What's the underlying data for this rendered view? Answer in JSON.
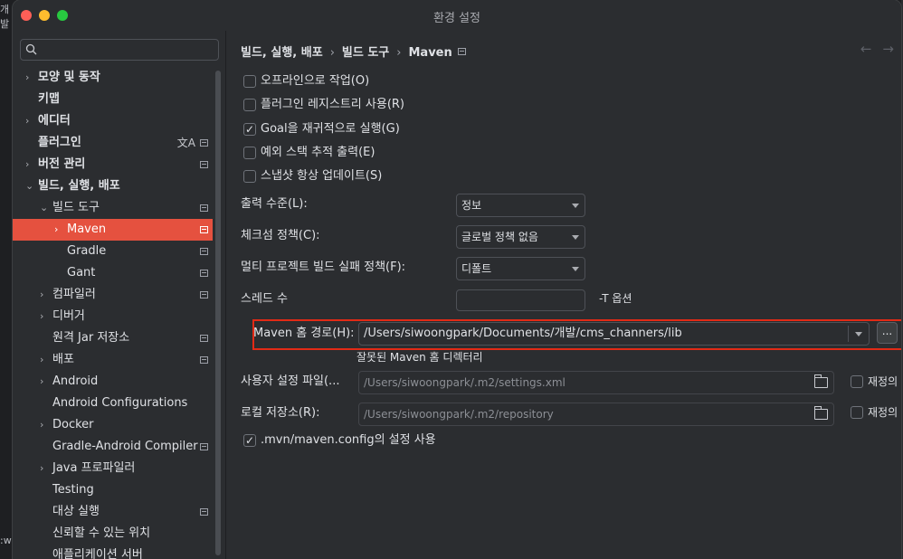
{
  "background": {
    "fragments": [
      "개발",
      ":w"
    ]
  },
  "window": {
    "title": "환경 설정"
  },
  "search": {
    "placeholder": ""
  },
  "sidebar": {
    "items": [
      {
        "label": "모양 및 동작",
        "chevron": "›",
        "bold": true,
        "pin": false
      },
      {
        "label": "키맵",
        "chevron": "",
        "bold": true,
        "pin": false
      },
      {
        "label": "에디터",
        "chevron": "›",
        "bold": true,
        "pin": false
      },
      {
        "label": "플러그인",
        "chevron": "",
        "bold": true,
        "pin": true,
        "translate": "文A"
      },
      {
        "label": "버전 관리",
        "chevron": "›",
        "bold": true,
        "pin": true
      },
      {
        "label": "빌드, 실행, 배포",
        "chevron": "⌄",
        "bold": true,
        "pin": false
      },
      {
        "label": "빌드 도구",
        "chevron": "⌄",
        "bold": false,
        "pin": true
      },
      {
        "label": "Maven",
        "chevron": "›",
        "bold": false,
        "pin": true,
        "selected": true
      },
      {
        "label": "Gradle",
        "chevron": "",
        "bold": false,
        "pin": true
      },
      {
        "label": "Gant",
        "chevron": "",
        "bold": false,
        "pin": true
      },
      {
        "label": "컴파일러",
        "chevron": "›",
        "bold": false,
        "pin": true
      },
      {
        "label": "디버거",
        "chevron": "›",
        "bold": false,
        "pin": false
      },
      {
        "label": "원격 Jar 저장소",
        "chevron": "",
        "bold": false,
        "pin": true
      },
      {
        "label": "배포",
        "chevron": "›",
        "bold": false,
        "pin": true
      },
      {
        "label": "Android",
        "chevron": "›",
        "bold": false,
        "pin": false
      },
      {
        "label": "Android Configurations",
        "chevron": "",
        "bold": false,
        "pin": false
      },
      {
        "label": "Docker",
        "chevron": "›",
        "bold": false,
        "pin": false
      },
      {
        "label": "Gradle-Android Compiler",
        "chevron": "",
        "bold": false,
        "pin": true
      },
      {
        "label": "Java 프로파일러",
        "chevron": "›",
        "bold": false,
        "pin": false
      },
      {
        "label": "Testing",
        "chevron": "",
        "bold": false,
        "pin": false
      },
      {
        "label": "대상 실행",
        "chevron": "",
        "bold": false,
        "pin": true
      },
      {
        "label": "신뢰할 수 있는 위치",
        "chevron": "",
        "bold": false,
        "pin": false
      },
      {
        "label": "애플리케이션 서버",
        "chevron": "",
        "bold": false,
        "pin": false
      }
    ]
  },
  "breadcrumb": {
    "parts": [
      "빌드, 실행, 배포",
      "빌드 도구",
      "Maven"
    ],
    "sep": "›"
  },
  "nav": {
    "back": "←",
    "forward": "→"
  },
  "checkboxes": [
    {
      "label": "오프라인으로 작업(O)",
      "checked": false
    },
    {
      "label": "플러그인 레지스트리 사용(R)",
      "checked": false
    },
    {
      "label": "Goal을 재귀적으로 실행(G)",
      "checked": true
    },
    {
      "label": "예외 스택 추적 출력(E)",
      "checked": false
    },
    {
      "label": "스냅샷 항상 업데이트(S)",
      "checked": false
    }
  ],
  "fields": {
    "output_level": {
      "label": "출력 수준(L):",
      "value": "정보"
    },
    "checksum": {
      "label": "체크섬 정책(C):",
      "value": "글로벌 정책 없음"
    },
    "multiproject": {
      "label": "멀티 프로젝트 빌드 실패 정책(F):",
      "value": "디폴트"
    },
    "threads": {
      "label": "스레드 수",
      "value": "",
      "suffix": "-T 옵션"
    },
    "maven_home": {
      "label": "Maven 홈 경로(H):",
      "value": "/Users/siwoongpark/Documents/개발/cms_channers/lib",
      "browse": "...",
      "error": "잘못된 Maven 홈 디렉터리"
    },
    "user_settings": {
      "label": "사용자 설정 파일(...",
      "value": "/Users/siwoongpark/.m2/settings.xml",
      "override": "재정의"
    },
    "local_repo": {
      "label": "로컬 저장소(R):",
      "value": "/Users/siwoongpark/.m2/repository",
      "override": "재정의"
    },
    "mvn_config": {
      "label": ".mvn/maven.config의 설정 사용",
      "checked": true
    }
  },
  "colors": {
    "accent": "#e5513f",
    "highlight_border": "#e22a16"
  }
}
